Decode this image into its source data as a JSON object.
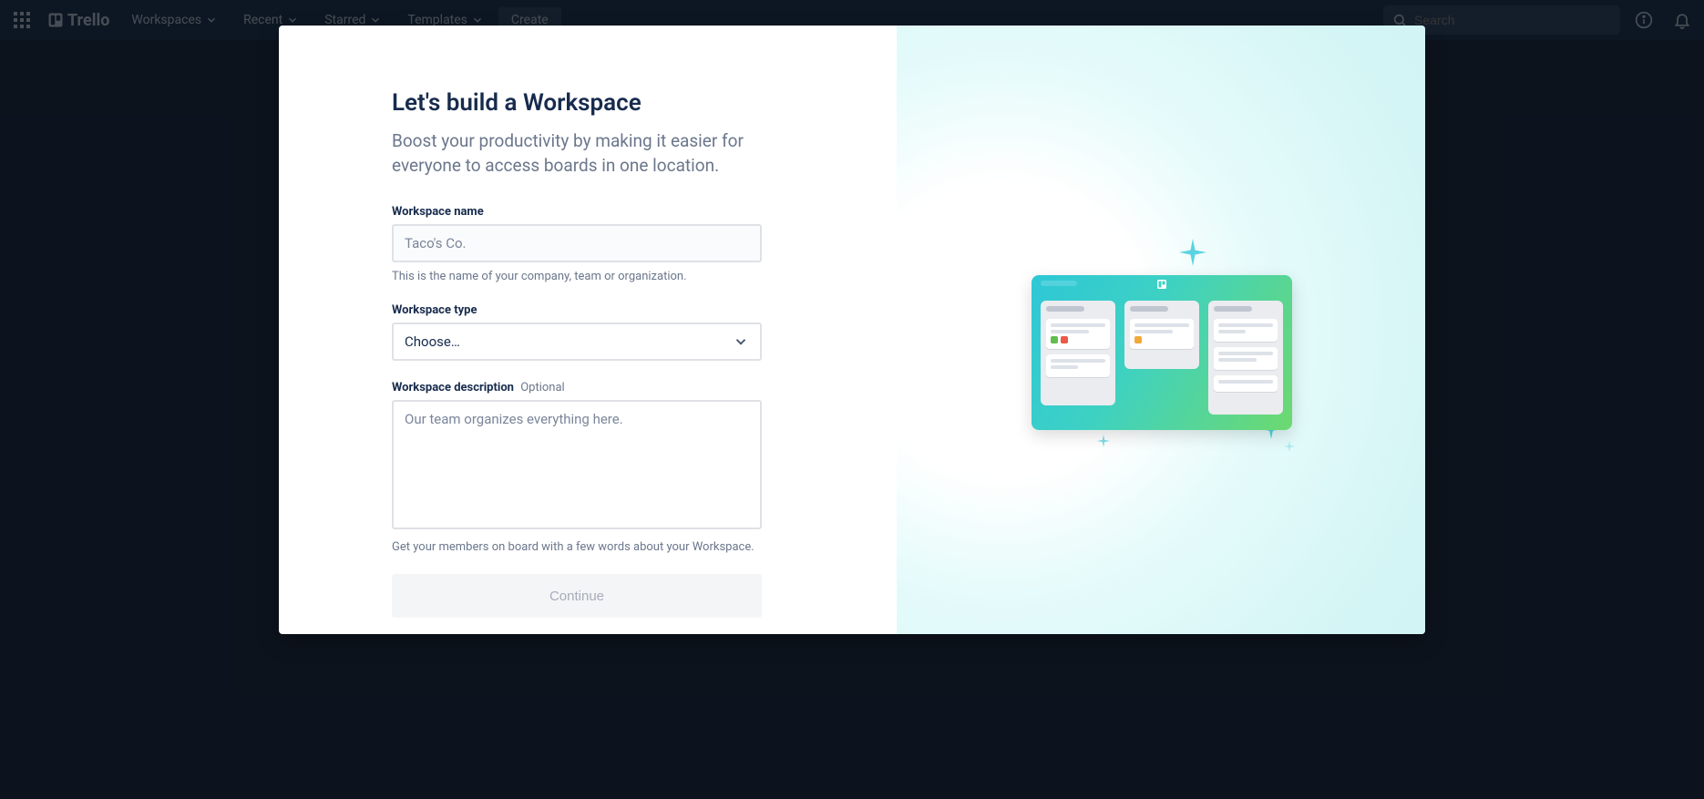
{
  "nav": {
    "brand": "Trello",
    "workspaces": "Workspaces",
    "recent": "Recent",
    "starred": "Starred",
    "templates": "Templates",
    "create": "Create",
    "search_placeholder": "Search"
  },
  "modal": {
    "title": "Let's build a Workspace",
    "subtitle": "Boost your productivity by making it easier for everyone to access boards in one location.",
    "name_label": "Workspace name",
    "name_placeholder": "Taco's Co.",
    "name_helper": "This is the name of your company, team or organization.",
    "type_label": "Workspace type",
    "type_placeholder": "Choose…",
    "desc_label": "Workspace description",
    "desc_optional": "Optional",
    "desc_placeholder": "Our team organizes everything here.",
    "desc_helper": "Get your members on board with a few words about your Workspace.",
    "continue": "Continue"
  }
}
